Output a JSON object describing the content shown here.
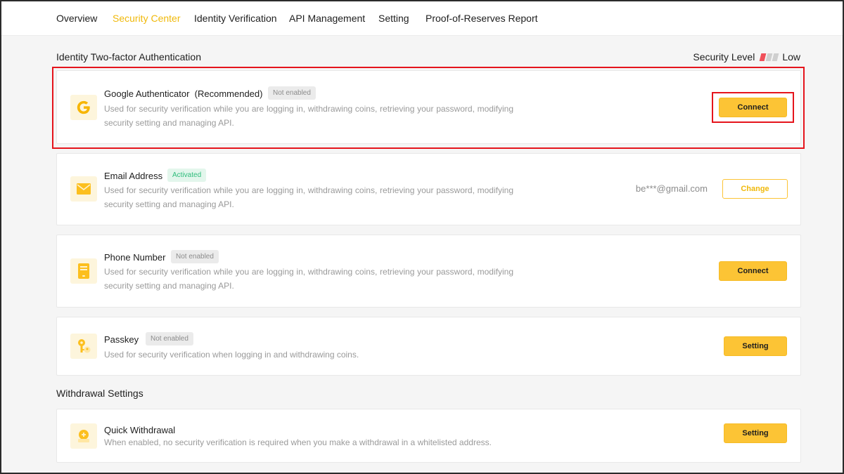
{
  "nav": {
    "tabs": [
      {
        "label": "Overview",
        "active": false
      },
      {
        "label": "Security Center",
        "active": true
      },
      {
        "label": "Identity Verification",
        "active": false
      },
      {
        "label": "API Management",
        "active": false
      },
      {
        "label": "Setting",
        "active": false
      },
      {
        "label": "Proof-of-Reserves Report",
        "active": false
      }
    ]
  },
  "two_factor": {
    "section_title": "Identity Two-factor Authentication",
    "security_level_label": "Security Level",
    "security_level_value": "Low",
    "security_level_colors": [
      "#f0505a",
      "#cfcfcf",
      "#cfcfcf"
    ]
  },
  "items": [
    {
      "icon": "google-authenticator-icon",
      "title": "Google Authenticator",
      "title_suffix": "(Recommended)",
      "status": "Not enabled",
      "description": "Used for security verification while you are logging in, withdrawing coins, retrieving your password, modifying security setting and managing API.",
      "action": "Connect"
    },
    {
      "icon": "envelope-icon",
      "title": "Email Address",
      "status": "Activated",
      "description": "Used for security verification while you are logging in, withdrawing coins, retrieving your password, modifying security setting and managing API.",
      "value": "be***@gmail.com",
      "action": "Change"
    },
    {
      "icon": "phone-icon",
      "title": "Phone Number",
      "status": "Not enabled",
      "description": "Used for security verification while you are logging in, withdrawing coins, retrieving your password, modifying security setting and managing API.",
      "action": "Connect"
    },
    {
      "icon": "passkey-icon",
      "title": "Passkey",
      "status": "Not enabled",
      "description": "Used for security verification when logging in and withdrawing coins.",
      "action": "Setting"
    }
  ],
  "withdrawal": {
    "section_title": "Withdrawal Settings",
    "items": [
      {
        "icon": "quick-withdrawal-icon",
        "title": "Quick Withdrawal",
        "description": "When enabled, no security verification is required when you make a withdrawal in a whitelisted address.",
        "action": "Setting"
      }
    ]
  },
  "colors": {
    "accent": "#fcc435",
    "brand_text": "#f0b90b",
    "highlight": "#e5141c",
    "activated": "#2ebc7b"
  }
}
